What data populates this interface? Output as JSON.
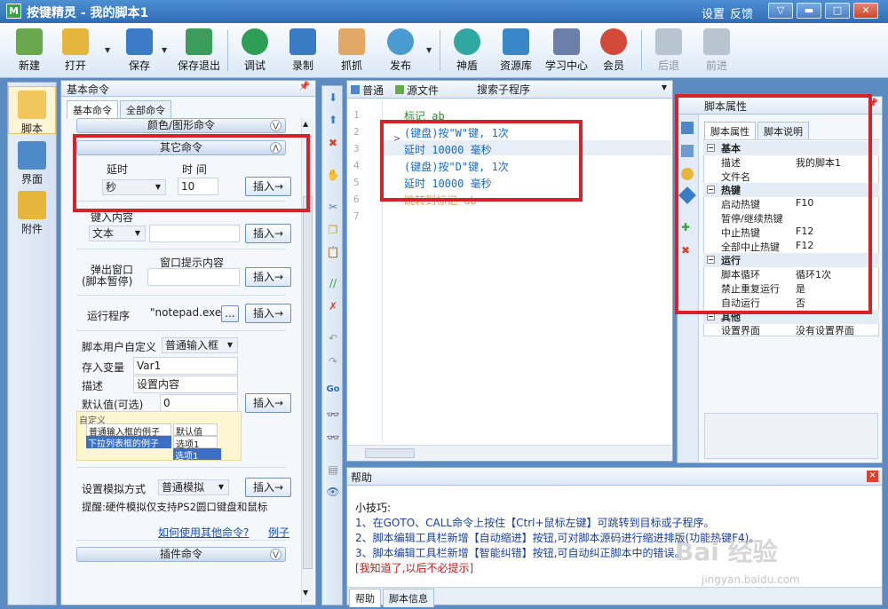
{
  "window": {
    "title": "按键精灵 - 我的脚本1",
    "settings": "设置",
    "feedback": "反馈"
  },
  "toolbar": [
    {
      "label": "新建",
      "icon": "new-doc-icon",
      "color": "#6aa84f"
    },
    {
      "label": "打开",
      "icon": "open-folder-icon",
      "color": "#e6b63c"
    },
    {
      "label": "保存",
      "icon": "save-icon",
      "color": "#3c7bc7"
    },
    {
      "label": "保存退出",
      "icon": "save-exit-icon",
      "color": "#3c9c5c"
    },
    {
      "label": "调试",
      "icon": "debug-icon",
      "color": "#2f9e55"
    },
    {
      "label": "录制",
      "icon": "record-icon",
      "color": "#3a7cc3"
    },
    {
      "label": "抓抓",
      "icon": "grab-icon",
      "color": "#e2a865"
    },
    {
      "label": "发布",
      "icon": "publish-icon",
      "color": "#4a9bd0"
    },
    {
      "label": "神盾",
      "icon": "shield-icon",
      "color": "#30a7a0"
    },
    {
      "label": "资源库",
      "icon": "resource-icon",
      "color": "#3a87c8"
    },
    {
      "label": "学习中心",
      "icon": "learning-icon",
      "color": "#6b7fa8"
    },
    {
      "label": "会员",
      "icon": "member-icon",
      "color": "#d14a3a"
    },
    {
      "label": "后退",
      "icon": "back-arrow-icon",
      "color": "#b8c4d0"
    },
    {
      "label": "前进",
      "icon": "forward-arrow-icon",
      "color": "#b8c4d0"
    }
  ],
  "leftnav": [
    {
      "label": "脚本"
    },
    {
      "label": "界面"
    },
    {
      "label": "附件"
    }
  ],
  "commands": {
    "header": "基本命令",
    "tab_basic": "基本命令",
    "tab_all": "全部命令",
    "group_color": "颜色/图形命令",
    "group_other": "其它命令",
    "group_plugin": "插件命令",
    "delay_label": "延时",
    "time_label": "时 间",
    "delay_unit": "秒",
    "delay_value": "10",
    "insert": "插入→",
    "keyin_label": "键入内容",
    "keyin_type": "文本",
    "popup_label1": "弹出窗口",
    "popup_label2": "(脚本暂停)",
    "popup_content_label": "窗口提示内容",
    "run_label": "运行程序",
    "run_value": "\"notepad.exe\"",
    "browse": "...",
    "custom_label": "脚本用户自定义",
    "custom_type": "普通输入框",
    "var_label": "存入变量",
    "var_value": "Var1",
    "desc_label": "描述",
    "desc_value": "设置内容",
    "default_label": "默认值(可选)",
    "default_value": "0",
    "preview_title": "自定义",
    "preview_row1_label": "普通输入框的例子",
    "preview_row1_value": "默认值",
    "preview_row2_label": "下拉列表框的例子",
    "preview_row2_value": "选项1",
    "preview_option": "选项1",
    "sim_label": "设置模拟方式",
    "sim_value": "普通模拟",
    "tip": "提醒:硬件模拟仅支持PS2圆口键盘和鼠标",
    "howto_link": "如何使用其他命令?",
    "example_link": "例子"
  },
  "editor": {
    "tab_normal": "普通",
    "tab_source": "源文件",
    "search_sub": "搜索子程序",
    "line_numbers": [
      "1",
      "2",
      "3",
      "4",
      "5",
      "6",
      "7"
    ],
    "lines": [
      "标记 ab",
      "(键盘)按\"W\"键, 1次",
      "延时 10000 毫秒",
      "(键盘)按\"D\"键, 1次",
      "延时 10000 毫秒",
      "跳转到标记 ab"
    ]
  },
  "props": {
    "header": "脚本属性",
    "tab_props": "脚本属性",
    "tab_desc": "脚本说明",
    "rows": [
      {
        "cat": true,
        "k": "基本"
      },
      {
        "k": "描述",
        "v": "我的脚本1"
      },
      {
        "k": "文件名",
        "v": ""
      },
      {
        "cat": true,
        "k": "热键"
      },
      {
        "k": "启动热键",
        "v": "F10"
      },
      {
        "k": "暂停/继续热键",
        "v": ""
      },
      {
        "k": "中止热键",
        "v": "F12"
      },
      {
        "k": "全部中止热键",
        "v": "F12"
      },
      {
        "cat": true,
        "k": "运行"
      },
      {
        "k": "脚本循环",
        "v": "循环1次"
      },
      {
        "k": "禁止重复运行",
        "v": "是"
      },
      {
        "k": "自动运行",
        "v": "否"
      },
      {
        "cat": true,
        "k": "其他"
      },
      {
        "k": "设置界面",
        "v": "没有设置界面"
      }
    ]
  },
  "help": {
    "header": "帮助",
    "title": "小技巧:",
    "tip1": "1、在GOTO、CALL命令上按住【Ctrl+鼠标左键】可跳转到目标或子程序。",
    "tip2": "2、脚本编辑工具栏新增【自动缩进】按钮,可对脚本源码进行缩进排版(功能热键F4)。",
    "tip3": "3、脚本编辑工具栏新增【智能纠错】按钮,可自动纠正脚本中的错误。",
    "dismiss": "[我知道了,以后不必提示]",
    "tab_help": "帮助",
    "tab_info": "脚本信息",
    "watermark": "Bai 经验",
    "watermark_url": "jingyan.baidu.com"
  }
}
